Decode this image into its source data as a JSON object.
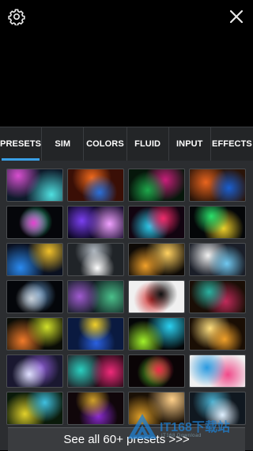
{
  "header": {
    "settings_icon": "gear-icon",
    "close_icon": "close-icon"
  },
  "tabs": [
    {
      "label": "PRESETS",
      "active": true
    },
    {
      "label": "SIM",
      "active": false
    },
    {
      "label": "COLORS",
      "active": false
    },
    {
      "label": "FLUID",
      "active": false
    },
    {
      "label": "INPUT",
      "active": false
    },
    {
      "label": "EFFECTS",
      "active": false
    }
  ],
  "accent_color": "#3aa0e6",
  "presets": [
    {
      "colors": [
        "#0e1a2a",
        "#d84fd0",
        "#4fe0e0"
      ]
    },
    {
      "colors": [
        "#3a0f06",
        "#2a6fd8",
        "#f26a1c"
      ]
    },
    {
      "colors": [
        "#06170b",
        "#1ea64a",
        "#c81e7a"
      ]
    },
    {
      "colors": [
        "#2a1408",
        "#1a5fd0",
        "#e8641e"
      ]
    },
    {
      "colors": [
        "#05060a",
        "#e83fd0",
        "#2af0a0"
      ]
    },
    {
      "colors": [
        "#0a0520",
        "#7a3ff0",
        "#f0a0ff"
      ]
    },
    {
      "colors": [
        "#120410",
        "#f02a6a",
        "#2ad0f0"
      ]
    },
    {
      "colors": [
        "#040608",
        "#2ae06a",
        "#f0d02a"
      ]
    },
    {
      "colors": [
        "#0a1020",
        "#f0c02a",
        "#2a8af0"
      ]
    },
    {
      "colors": [
        "#202428",
        "#ffffff",
        "#b0b8c0"
      ]
    },
    {
      "colors": [
        "#0e0a06",
        "#f0a02a",
        "#ffd060"
      ]
    },
    {
      "colors": [
        "#1a1e28",
        "#70c8f0",
        "#f0f0f0"
      ]
    },
    {
      "colors": [
        "#04060a",
        "#c8d0d8",
        "#6090c0"
      ]
    },
    {
      "colors": [
        "#101c20",
        "#a05ad0",
        "#4ac08a"
      ]
    },
    {
      "colors": [
        "#f0f0f0",
        "#101010",
        "#d02a2a"
      ]
    },
    {
      "colors": [
        "#1a0e06",
        "#2ab0a0",
        "#c02a5a"
      ]
    },
    {
      "colors": [
        "#0a0c06",
        "#d0e02a",
        "#f07a2a"
      ]
    },
    {
      "colors": [
        "#0a1a40",
        "#f0d02a",
        "#2a60e0"
      ]
    },
    {
      "colors": [
        "#040608",
        "#a0f02a",
        "#2ad0f0"
      ]
    },
    {
      "colors": [
        "#1a0e04",
        "#f0a02a",
        "#ffe080"
      ]
    },
    {
      "colors": [
        "#1a1830",
        "#e0e0ff",
        "#8a5ad0"
      ]
    },
    {
      "colors": [
        "#200a14",
        "#f02a7a",
        "#2ad0c0"
      ]
    },
    {
      "colors": [
        "#0a0406",
        "#f02a4a",
        "#5ad02a"
      ]
    },
    {
      "colors": [
        "#f0f0f0",
        "#2a9ae0",
        "#f04a8a"
      ]
    },
    {
      "colors": [
        "#0a1a0a",
        "#40c0e0",
        "#e0d02a"
      ]
    },
    {
      "colors": [
        "#10060a",
        "#d0a02a",
        "#8a2ad0"
      ]
    },
    {
      "colors": [
        "#1a1006",
        "#e0a02a",
        "#ffd08a"
      ]
    },
    {
      "colors": [
        "#101820",
        "#e0f0ff",
        "#4ab0d0"
      ]
    }
  ],
  "see_all_label": "See all 60+ presets >>>",
  "watermark": {
    "main": "IT168下载站",
    "sub": "IT168 Download"
  }
}
